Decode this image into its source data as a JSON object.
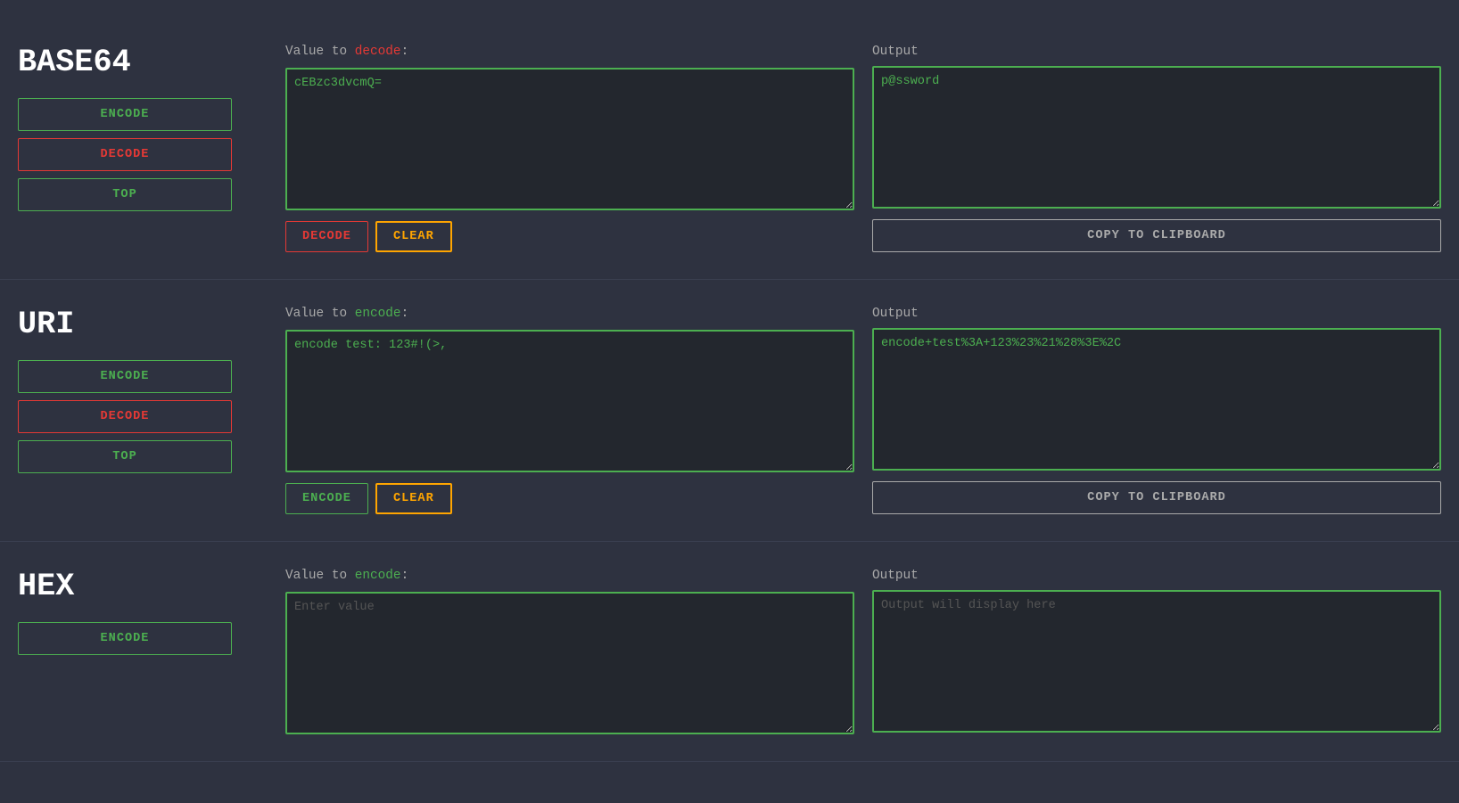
{
  "base64": {
    "title": "BASE64",
    "encode_btn": "ENCODE",
    "decode_btn": "DECODE",
    "top_btn": "TOP",
    "input_label_pre": "Value to ",
    "input_label_action": "decode",
    "input_label_post": ":",
    "input_value": "cEBzc3dvcmQ=",
    "output_label": "Output",
    "output_value": "p@ssword",
    "action_decode_btn": "DECODE",
    "action_clear_btn": "CLEAR",
    "copy_btn": "COPY TO CLIPBOARD",
    "input_placeholder": "",
    "output_placeholder": ""
  },
  "uri": {
    "title": "URI",
    "encode_btn": "ENCODE",
    "decode_btn": "DECODE",
    "top_btn": "TOP",
    "input_label_pre": "Value to ",
    "input_label_action": "encode",
    "input_label_post": ":",
    "input_value": "encode test: 123#!(>,",
    "output_label": "Output",
    "output_value": "encode+test%3A+123%23%21%28%3E%2C",
    "action_encode_btn": "ENCODE",
    "action_clear_btn": "CLEAR",
    "copy_btn": "COPY TO CLIPBOARD",
    "input_placeholder": "",
    "output_placeholder": ""
  },
  "hex": {
    "title": "HEX",
    "encode_btn": "ENCODE",
    "input_label_pre": "Value to ",
    "input_label_action": "encode",
    "input_label_post": ":",
    "input_value": "",
    "output_label": "Output",
    "output_value": "",
    "input_placeholder": "Enter value",
    "output_placeholder": "Output will display here"
  }
}
